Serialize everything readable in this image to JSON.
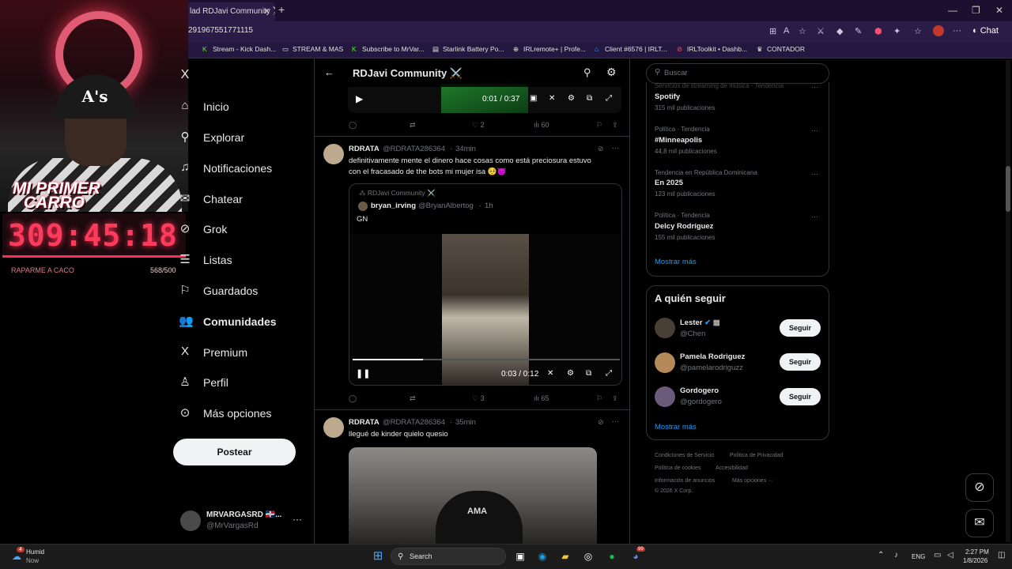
{
  "browser": {
    "tab_title": "lad RDJavi Community ⚔️",
    "url": "291967551771115",
    "bookmarks": [
      "Stream - Kick Dash...",
      "STREAM & MAS",
      "Subscribe to MrVar...",
      "Starlink Battery Po...",
      "IRLremote+ | Profe...",
      "Client #6576 | IRLT...",
      "IRLToolkit • Dashb...",
      "CONTADOR"
    ],
    "chat_label": "Chat"
  },
  "overlay": {
    "banner": "MI PRIMER CARRO",
    "banner_line1": "MI PRIMER",
    "banner_line2": "CARRO",
    "cap_logo": "A's",
    "timer": "309:45:18",
    "sub_left": "RAPARME A CACO",
    "sub_right": "568/500"
  },
  "nav": {
    "items": [
      {
        "label": "Inicio",
        "icon": "home-icon"
      },
      {
        "label": "Explorar",
        "icon": "search-icon"
      },
      {
        "label": "Notificaciones",
        "icon": "bell-icon"
      },
      {
        "label": "Chatear",
        "icon": "mail-icon"
      },
      {
        "label": "Grok",
        "icon": "grok-icon"
      },
      {
        "label": "Listas",
        "icon": "list-icon"
      },
      {
        "label": "Guardados",
        "icon": "bookmark-icon"
      },
      {
        "label": "Comunidades",
        "icon": "people-icon"
      },
      {
        "label": "Premium",
        "icon": "x-logo-icon"
      },
      {
        "label": "Perfil",
        "icon": "person-icon"
      },
      {
        "label": "Más opciones",
        "icon": "more-circle-icon"
      }
    ],
    "post_button": "Postear",
    "account_name": "MRVARGASRD 🇩🇴...",
    "account_handle": "@MrVargasRd"
  },
  "center": {
    "title": "RDJavi Community ⚔️",
    "top_video": {
      "time": "0:01 / 0:37"
    },
    "top_actions": {
      "replies": "",
      "reposts": "",
      "likes": "2",
      "views": "60"
    },
    "posts": [
      {
        "name": "RDRATA",
        "handle": "@RDRATA286364",
        "time": "34min",
        "text_line1": "definitivamente mente el dinero hace cosas como está preciosura estuvo",
        "text_line2": "con el fracasado de the bots mi mujer isa 🥺😈",
        "quote": {
          "community": "RDJavi Community ⚔️",
          "name": "bryan_irving",
          "handle": "@BryanAlbertog",
          "time": "1h",
          "text": "GN",
          "video_time": "0:03 / 0:12"
        },
        "likes": "3",
        "views": "65"
      },
      {
        "name": "RDRATA",
        "handle": "@RDRATA286364",
        "time": "35min",
        "text_line1": "llegué de kinder quielo quesio",
        "image_text": "AMA"
      }
    ]
  },
  "right": {
    "search_placeholder": "Buscar",
    "trends": [
      {
        "category": "Servicios de streaming de música · Tendencia",
        "name": "Spotify",
        "count": "315 mil publicaciones"
      },
      {
        "category": "Política · Tendencia",
        "name": "#Minneapolis",
        "count": "44,8 mil publicaciones"
      },
      {
        "category": "Tendencia en República Dominicana",
        "name": "En 2025",
        "count": "123 mil publicaciones"
      },
      {
        "category": "Política · Tendencia",
        "name": "Delcy Rodríguez",
        "count": "155 mil publicaciones"
      }
    ],
    "show_more": "Mostrar más",
    "who_to_follow_title": "A quién seguir",
    "who_to_follow": [
      {
        "name": "Lester",
        "handle": "@Chen",
        "button": "Seguir"
      },
      {
        "name": "Pamela Rodriguez",
        "handle": "@pamelarodriguzz",
        "button": "Seguir"
      },
      {
        "name": "Gordogero",
        "handle": "@gordogero",
        "button": "Seguir"
      }
    ],
    "show_more_2": "Mostrar más",
    "footer": [
      "Condiciones de Servicio",
      "Política de Privacidad",
      "Política de cookies",
      "Accesibilidad",
      "Información de anuncios",
      "Más opciones ···",
      "© 2026 X Corp."
    ]
  },
  "taskbar": {
    "weather_label": "Humid",
    "weather_sub": "Now",
    "weather_badge": "4",
    "search_label": "Search",
    "lang": "ENG",
    "time": "2:27 PM",
    "date": "1/8/2026",
    "discord_badge": "99"
  },
  "colors": {
    "accent": "#1d9bf0",
    "border": "#2f3336",
    "muted": "#71767b",
    "timer": "#ff3b5c"
  }
}
